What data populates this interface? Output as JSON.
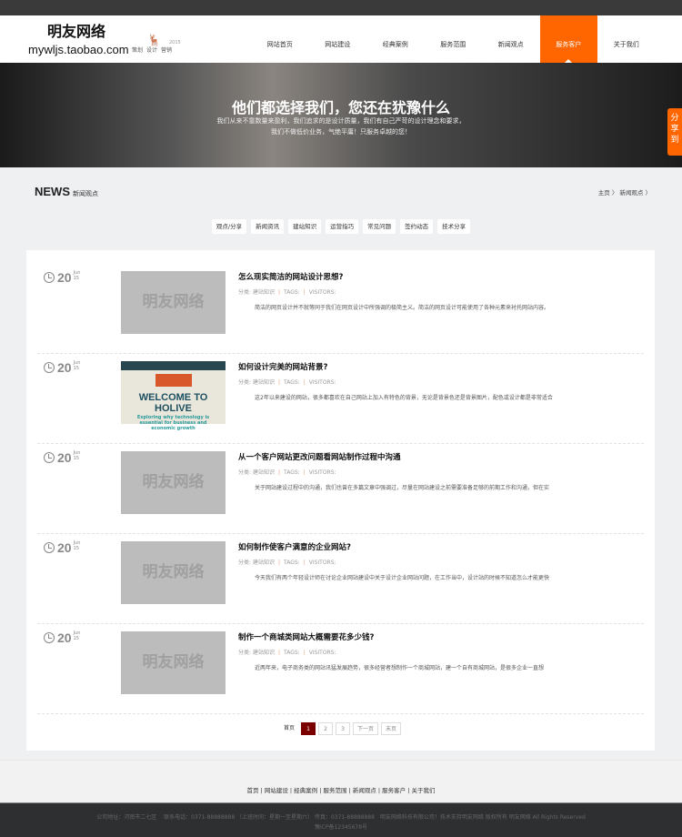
{
  "header": {
    "logo_cn": "明友网络",
    "logo_url": "mywljs.taobao.com",
    "logo_tags": [
      "策划",
      "设计",
      "营销"
    ],
    "logo_year": "2015",
    "nav": [
      "网站首页",
      "网站建设",
      "经典案例",
      "服务范围",
      "新闻观点",
      "服务客户",
      "关于我们"
    ],
    "active_index": 5
  },
  "banner": {
    "title": "他们都选择我们，您还在犹豫什么",
    "line1": "我们从来不靠数量来盈利，我们追求的是设计质量，我们有自己严苛的设计理念和要求，",
    "line2": "我们不做低价业务，气绝平庸！只服务卓越的您！"
  },
  "share": "分享到",
  "section": {
    "title_en": "NEWS",
    "title_cn": "新闻观点",
    "breadcrumb": [
      "主页",
      "新闻观点"
    ]
  },
  "tabs": [
    "观点/分享",
    "新闻资讯",
    "建站知识",
    "运营指巧",
    "常见问题",
    "签约动态",
    "技术分享"
  ],
  "articles": [
    {
      "day": "20",
      "month": "Jun",
      "year": "15",
      "thumb": "明友网络",
      "title": "怎么现实简洁的网站设计思想?",
      "category_label": "分类:",
      "category": "建站知识",
      "tags": "TAGS:",
      "visitors": "VISITORS:",
      "desc": "简洁的网页设计并不就等同于我们在网页设计中所强调的极简主义。简洁的网页设计可能使用了各种元素来衬托网站内容。"
    },
    {
      "day": "20",
      "month": "Jun",
      "year": "15",
      "thumb": "WELCOME TO HOLIVE",
      "thumb_sub": "Exploring why technology is essential for business and economic growth",
      "title": "如何设计完美的网站背景?",
      "category_label": "分类:",
      "category": "建站知识",
      "tags": "TAGS:",
      "visitors": "VISITORS:",
      "desc": "这2年以来建设的网站，很多都喜欢在自己网站上加入有特色的背景，无论是背景色还是背景图片，配色或设计都是非常适合"
    },
    {
      "day": "20",
      "month": "Jun",
      "year": "15",
      "thumb": "明友网络",
      "title": "从一个客户网站更改问题看网站制作过程中沟通",
      "category_label": "分类:",
      "category": "建站知识",
      "tags": "TAGS:",
      "visitors": "VISITORS:",
      "desc": "关于网站建设过程中的沟通，我们也曾在多篇文章中强调过，尽量在网站建设之前需要准备足够的前期工作和沟通，但在实"
    },
    {
      "day": "20",
      "month": "Jun",
      "year": "15",
      "thumb": "明友网络",
      "title": "如何制作使客户满意的企业网站?",
      "category_label": "分类:",
      "category": "建站知识",
      "tags": "TAGS:",
      "visitors": "VISITORS:",
      "desc": "今天我们有两个年轻设计师在讨论企业网站建设中关于设计企业网站问题，在工作当中，设计站的时候不知道怎么才能更快"
    },
    {
      "day": "20",
      "month": "Jun",
      "year": "15",
      "thumb": "明友网络",
      "title": "制作一个商城类网站大概需要花多少钱?",
      "category_label": "分类:",
      "category": "建站知识",
      "tags": "TAGS:",
      "visitors": "VISITORS:",
      "desc": "近两年来，电子商务类的网站讯猛发展趋势，很多经营者想制作一个商城网站，建一个自有商城网站，是很多企业一直想"
    }
  ],
  "pager": {
    "first": "首页",
    "pages": [
      "1",
      "2",
      "3"
    ],
    "current": "1",
    "next": "下一页",
    "last": "末页"
  },
  "footer": {
    "links": [
      "首页",
      "网站建设",
      "经典案例",
      "服务范围",
      "新闻观点",
      "服务客户",
      "关于我们"
    ],
    "info": "公司地址：河南市二七区　 联系电话：0371-88888888 （上班时间：星期一至星期六） 传真：0371-88888888　明友网络科技有限公司！技术支持明友网络 版权所有 明友网络 All Rights Reserved",
    "icp": "豫ICP备12345678号"
  }
}
